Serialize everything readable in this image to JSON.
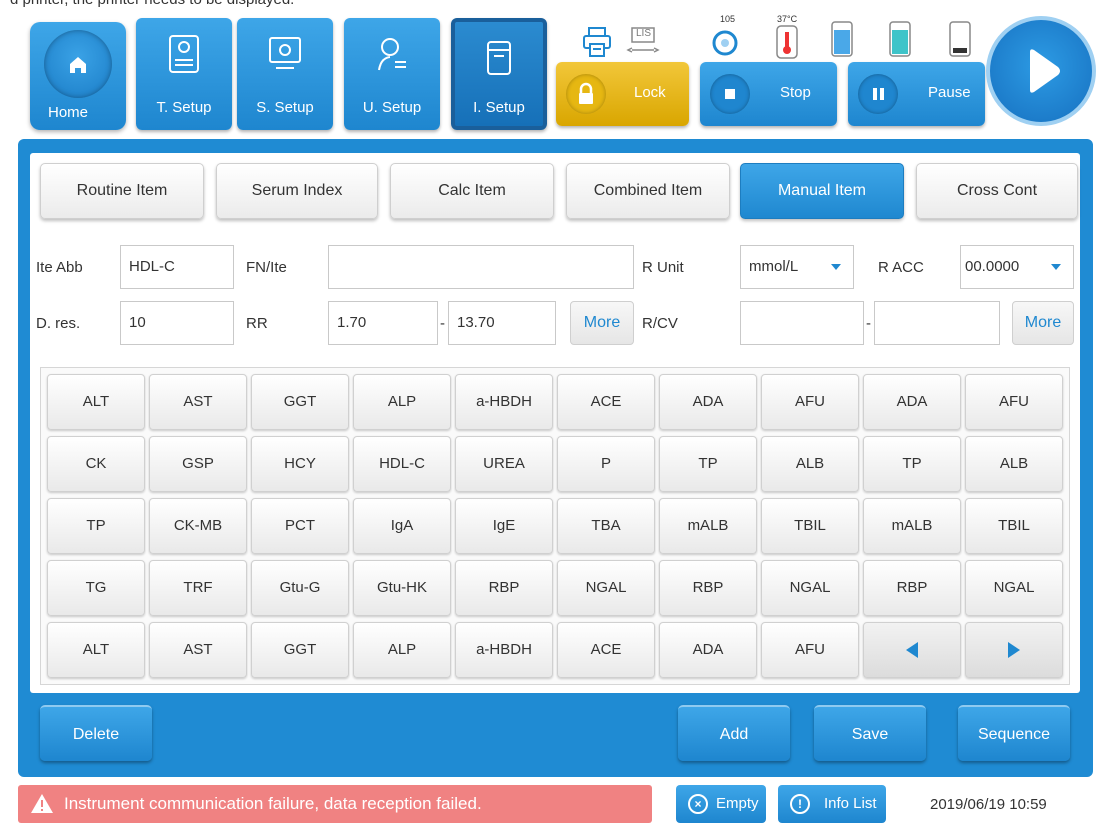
{
  "top_strip": "d printer, the printer needs to be displayed.",
  "toolbar": {
    "home_label": "Home",
    "nav": [
      {
        "label": "T. Setup",
        "icon": "test-setup-icon"
      },
      {
        "label": "S. Setup",
        "icon": "system-setup-icon"
      },
      {
        "label": "U. Setup",
        "icon": "user-setup-icon"
      },
      {
        "label": "I. Setup",
        "icon": "item-setup-icon",
        "active": true
      }
    ],
    "indicators": {
      "lis_label": "LIS",
      "temp_top": "105",
      "reagent_temp": "37°C"
    },
    "lock_label": "Lock",
    "stop_label": "Stop",
    "pause_label": "Pause"
  },
  "tabs": [
    {
      "label": "Routine Item"
    },
    {
      "label": "Serum Index"
    },
    {
      "label": "Calc Item"
    },
    {
      "label": "Combined Item"
    },
    {
      "label": "Manual Item",
      "active": true
    },
    {
      "label": "Cross Cont"
    }
  ],
  "form": {
    "ite_abb_label": "Ite Abb",
    "ite_abb_value": "HDL-C",
    "fn_ite_label": "FN/Ite",
    "fn_ite_value": "",
    "r_unit_label": "R Unit",
    "r_unit_value": "mmol/L",
    "r_acc_label": "R ACC",
    "r_acc_value": "00.0000",
    "d_res_label": "D. res.",
    "d_res_value": "10",
    "rr_label": "RR",
    "rr_low": "1.70",
    "rr_dash": "-",
    "rr_high": "13.70",
    "more_label": "More",
    "rcv_label": "R/CV",
    "rcv_low": "",
    "rcv_dash": "-",
    "rcv_high": "",
    "more2_label": "More"
  },
  "items": [
    [
      "ALT",
      "AST",
      "GGT",
      "ALP",
      "a-HBDH",
      "ACE",
      "ADA",
      "AFU",
      "ADA",
      "AFU"
    ],
    [
      "CK",
      "GSP",
      "HCY",
      "HDL-C",
      "UREA",
      "P",
      "TP",
      "ALB",
      "TP",
      "ALB"
    ],
    [
      "TP",
      "CK-MB",
      "PCT",
      "IgA",
      "IgE",
      "TBA",
      "mALB",
      "TBIL",
      "mALB",
      "TBIL"
    ],
    [
      "TG",
      "TRF",
      "Gtu-G",
      "Gtu-HK",
      "RBP",
      "NGAL",
      "RBP",
      "NGAL",
      "RBP",
      "NGAL"
    ],
    [
      "ALT",
      "AST",
      "GGT",
      "ALP",
      "a-HBDH",
      "ACE",
      "ADA",
      "AFU"
    ]
  ],
  "actions": {
    "delete": "Delete",
    "add": "Add",
    "save": "Save",
    "sequence": "Sequence"
  },
  "status": {
    "alarm_text": "Instrument communication failure, data reception failed.",
    "empty_label": "Empty",
    "info_label": "Info List",
    "datetime": "2019/06/19 10:59"
  },
  "colors": {
    "accent": "#1f88d0",
    "alarm": "#f08282",
    "lock": "#e6b712"
  }
}
